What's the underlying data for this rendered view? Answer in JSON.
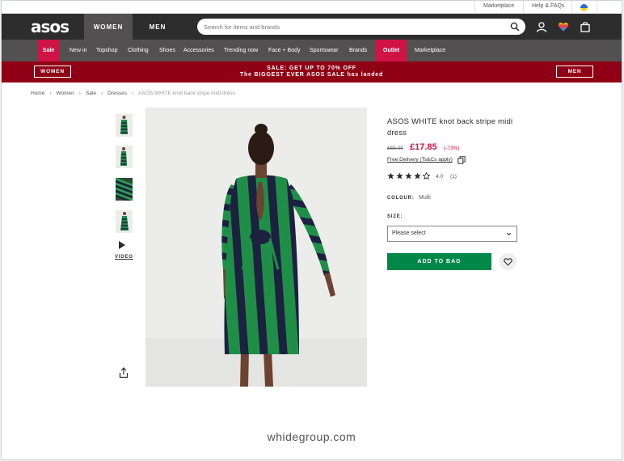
{
  "utility": {
    "marketplace": "Marketplace",
    "help": "Help & FAQs",
    "flag_icon": "ukraine-flag-icon"
  },
  "header": {
    "logo": "asos",
    "women_tab": "WOMEN",
    "men_tab": "MEN",
    "search_placeholder": "Search for items and brands",
    "icons": [
      "search-icon",
      "account-icon",
      "saved-items-heart-icon",
      "bag-icon"
    ]
  },
  "nav": {
    "items": [
      "Sale",
      "New in",
      "Topshop",
      "Clothing",
      "Shoes",
      "Accessories",
      "Trending now",
      "Face + Body",
      "Sportswear",
      "Brands",
      "Outlet",
      "Marketplace"
    ]
  },
  "banner": {
    "left_button": "WOMEN",
    "right_button": "MEN",
    "line1": "SALE: GET UP TO 70% OFF",
    "line2": "The BIGGEST EVER ASOS SALE has landed"
  },
  "breadcrumb": [
    "Home",
    "Women",
    "Sale",
    "Dresses",
    "ASOS WHITE knot back stripe midi dress"
  ],
  "gallery": {
    "video_label": "VIDEO",
    "icons": [
      "play-icon",
      "share-icon"
    ]
  },
  "product": {
    "title": "ASOS WHITE knot back stripe midi dress",
    "was_price": "£65.00",
    "now_price": "£17.85",
    "discount": "(-73%)",
    "delivery": "Free Delivery (Ts&Cs apply)",
    "rating": "4.0",
    "review_count": "(1)",
    "stars_filled": 4,
    "colour_label": "COLOUR:",
    "colour_value": "Multi",
    "size_label": "SIZE:",
    "size_value": "Please select",
    "add_to_bag": "ADD TO BAG"
  },
  "colors": {
    "brand_dark": "#2d2d2d",
    "sale": "#d01345",
    "banner": "#8f0014",
    "add_to_bag": "#018849"
  },
  "watermark": "whidegroup.com"
}
